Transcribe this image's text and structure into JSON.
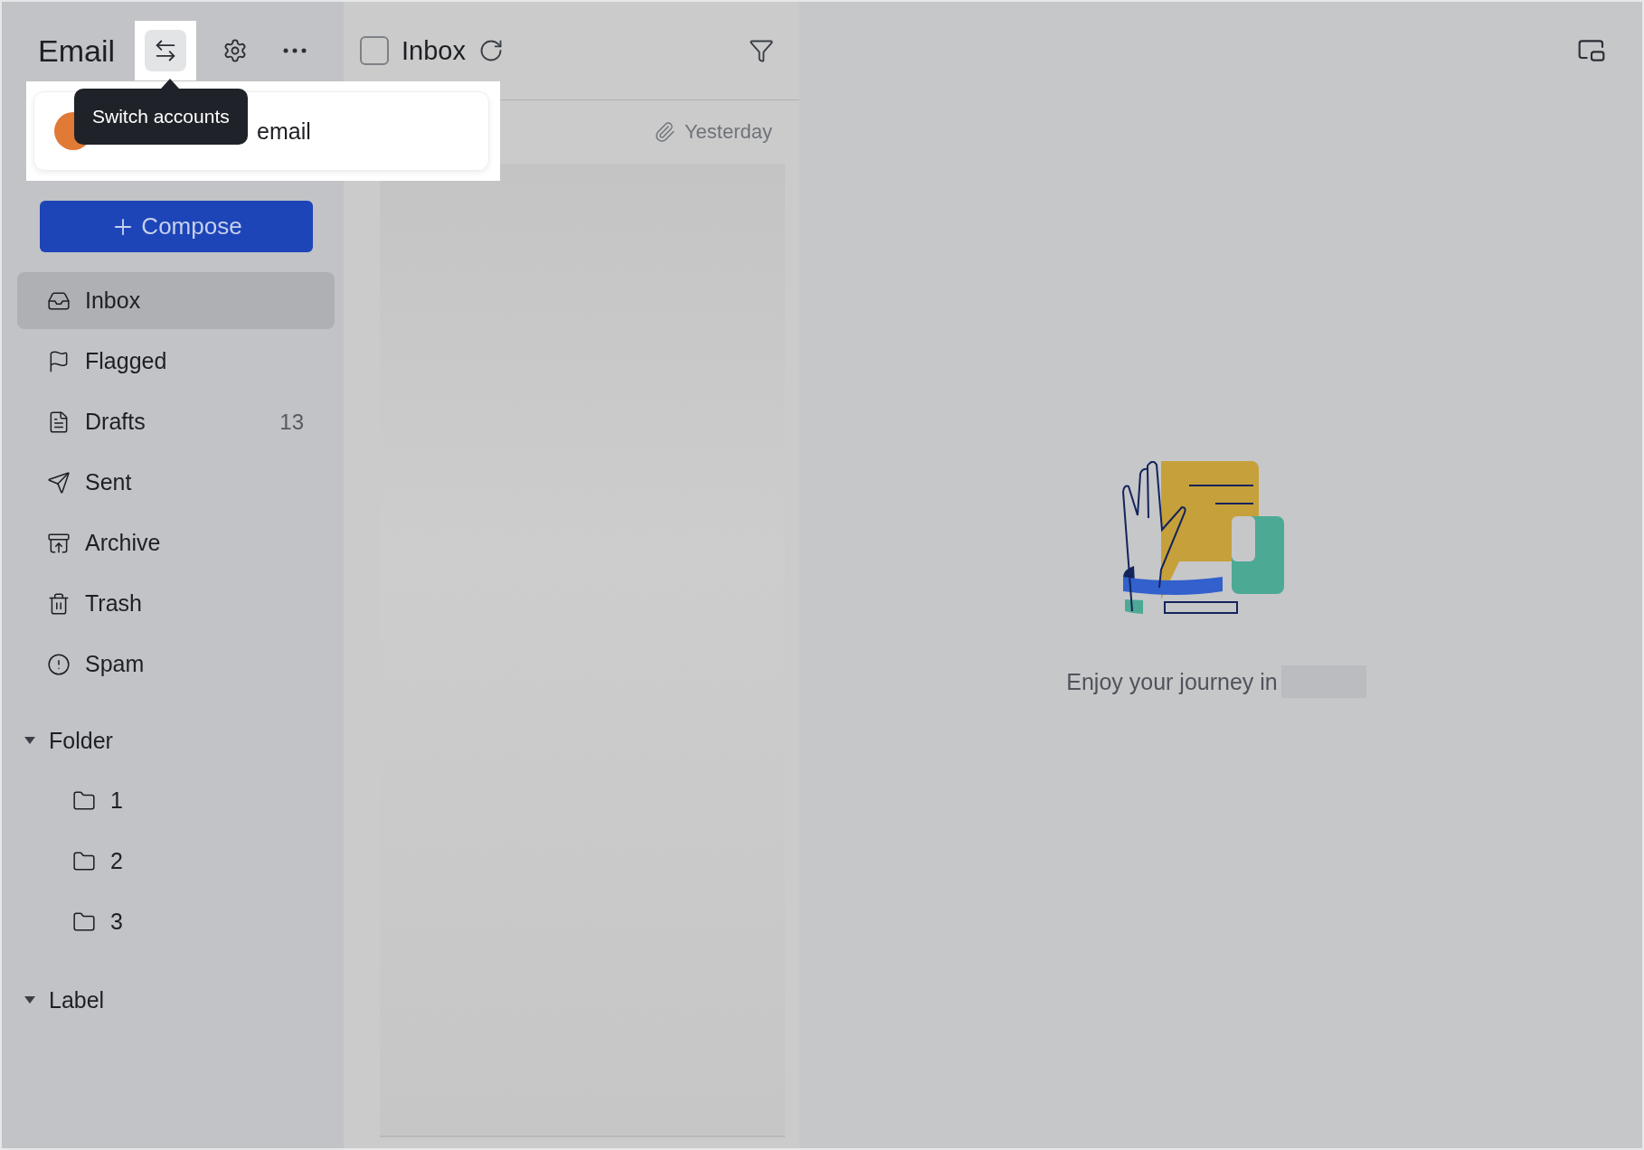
{
  "sidebar": {
    "title": "Email",
    "tooltip": "Switch accounts",
    "account": {
      "name": "email"
    },
    "compose": "Compose",
    "items": [
      {
        "label": "Inbox",
        "selected": true
      },
      {
        "label": "Flagged",
        "selected": false
      },
      {
        "label": "Drafts",
        "selected": false,
        "count": "13"
      },
      {
        "label": "Sent",
        "selected": false
      },
      {
        "label": "Archive",
        "selected": false
      },
      {
        "label": "Trash",
        "selected": false
      },
      {
        "label": "Spam",
        "selected": false
      }
    ],
    "groups": [
      {
        "label": "Folder",
        "expanded": true,
        "children": [
          {
            "label": "1"
          },
          {
            "label": "2"
          },
          {
            "label": "3"
          }
        ]
      },
      {
        "label": "Label",
        "expanded": true
      }
    ]
  },
  "list": {
    "title": "Inbox",
    "checked": false,
    "rows": [
      {
        "date": "Yesterday"
      }
    ]
  },
  "empty_state": {
    "message": "Enjoy your journey in"
  }
}
